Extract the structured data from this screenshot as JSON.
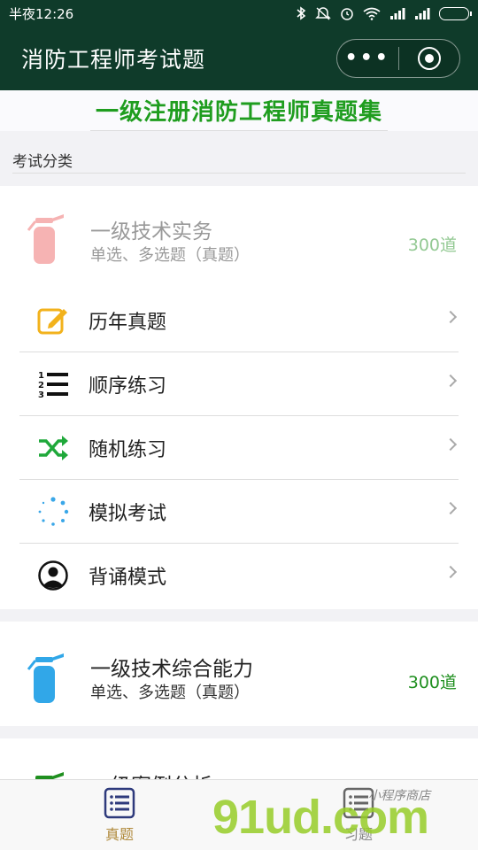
{
  "status_bar": {
    "carrier_time": "半夜12:26"
  },
  "nav": {
    "title": "消防工程师考试题",
    "more_label": "•••"
  },
  "banner": {
    "title": "一级注册消防工程师真题集"
  },
  "section": {
    "label": "考试分类"
  },
  "subjects": [
    {
      "name": "一级技术实务",
      "desc": "单选、多选题（真题）",
      "count": "300道",
      "icon_color": "#f6b3b3",
      "name_color": "#999999",
      "count_color": "#93c993"
    },
    {
      "name": "一级技术综合能力",
      "desc": "单选、多选题（真题）",
      "count": "300道",
      "icon_color": "#31a7e8",
      "name_color": "#222222",
      "count_color": "#1f8f1f"
    },
    {
      "name": "一级案例分析",
      "icon_color": "#1f8f1f"
    }
  ],
  "menu": [
    {
      "label": "历年真题",
      "icon": "edit-icon"
    },
    {
      "label": "顺序练习",
      "icon": "ordered-list-icon"
    },
    {
      "label": "随机练习",
      "icon": "shuffle-icon"
    },
    {
      "label": "模拟考试",
      "icon": "loading-dots-icon"
    },
    {
      "label": "背诵模式",
      "icon": "user-icon"
    }
  ],
  "tabs": [
    {
      "label": "真题",
      "icon": "exam-list-icon",
      "color": "#b08a3c"
    },
    {
      "label": "习题",
      "icon": "exercise-list-icon",
      "color": "#888888"
    }
  ],
  "watermark": {
    "brand": "91ud.com",
    "sub": "小程序商店"
  },
  "colors": {
    "header_bg": "#0f3b2a",
    "banner_green": "#1f9d1f",
    "tab_active": "#b08a3c"
  }
}
